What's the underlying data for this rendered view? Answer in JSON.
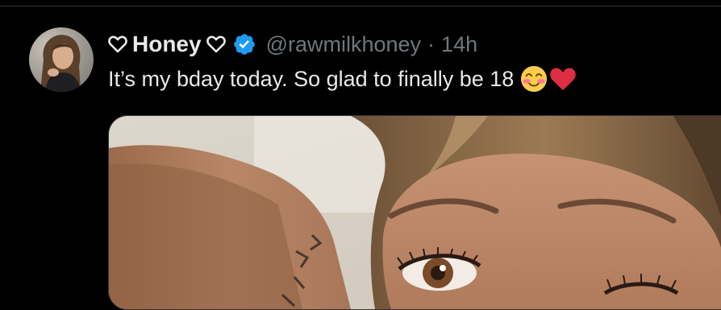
{
  "tweet": {
    "author": {
      "display_name": "Honey",
      "handle": "@rawmilkhoney",
      "verified": true,
      "name_decoration_icon": "heart-outline-icon"
    },
    "separator": "·",
    "timestamp": "14h",
    "text": "It’s my bday today. So glad to finally be 18",
    "text_emojis": [
      "smiling-face-with-blush-emoji",
      "red-heart-emoji"
    ],
    "media": {
      "type": "photo"
    }
  },
  "colors": {
    "background": "#000000",
    "primary_text": "#e7e9ea",
    "secondary_text": "#71767b",
    "verified_blue": "#1d9bf0",
    "divider": "#2f3336"
  }
}
